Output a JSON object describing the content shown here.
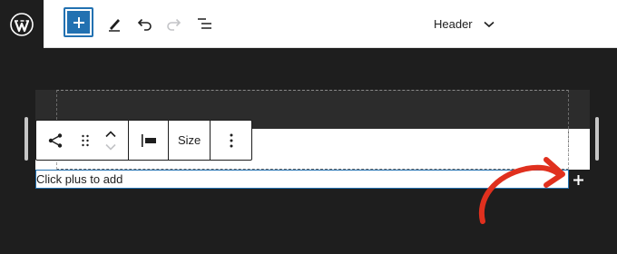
{
  "toolbar": {
    "inserter_icon": "plus-icon",
    "tools_icon": "pencil-icon",
    "undo_icon": "undo-icon",
    "redo_icon": "redo-icon",
    "list_view_icon": "list-view-icon",
    "document_title": "Header",
    "title_dropdown_icon": "chevron-down-icon"
  },
  "block_toolbar": {
    "block_type_icon": "share-icon",
    "drag_icon": "drag-handle-icon",
    "move_up_icon": "chevron-up-icon",
    "move_down_icon": "chevron-down-icon",
    "justify_icon": "justify-left-icon",
    "size_label": "Size",
    "options_icon": "more-vertical-icon"
  },
  "block": {
    "placeholder_text": "Click plus to add",
    "add_icon": "plus-icon"
  },
  "colors": {
    "accent": "#2271b1",
    "annotation": "#e0301e",
    "canvas": "#1e1e1e"
  }
}
